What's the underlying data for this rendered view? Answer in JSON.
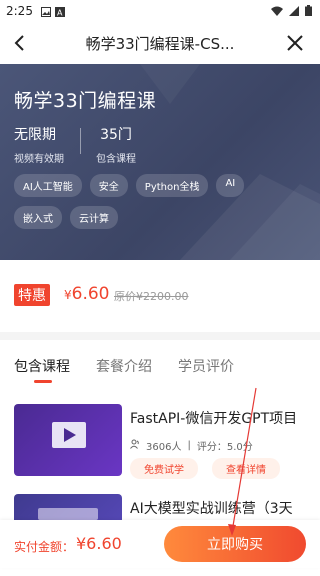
{
  "status_bar": {
    "time": "2:25"
  },
  "nav": {
    "title": "畅学33门编程课-CS..."
  },
  "hero": {
    "title": "畅学33门编程课",
    "stats": [
      {
        "value": "无限期",
        "label": "视频有效期"
      },
      {
        "value": "35门",
        "label": "包含课程"
      }
    ],
    "tags": [
      "AI人工智能",
      "安全",
      "Python全栈",
      "AI",
      "嵌入式",
      "云计算"
    ]
  },
  "price": {
    "badge": "特惠",
    "currency": "¥",
    "current": "6.60",
    "original": "原价¥2200.00"
  },
  "tabs": [
    "包含课程",
    "套餐介绍",
    "学员评价"
  ],
  "courses": [
    {
      "title": "FastAPI-微信开发GPT项目",
      "students": "3606人",
      "rating": "评分：5.0分",
      "btn_free": "免费试学",
      "btn_detail": "查看详情"
    },
    {
      "title": "AI大模型实战训练营（3天"
    }
  ],
  "bottom": {
    "pay_label": "实付金额：",
    "pay_amount": "¥6.60",
    "buy_label": "立即购买"
  },
  "colors": {
    "accent": "#f0442e",
    "hero_bg": "#434c6d"
  }
}
